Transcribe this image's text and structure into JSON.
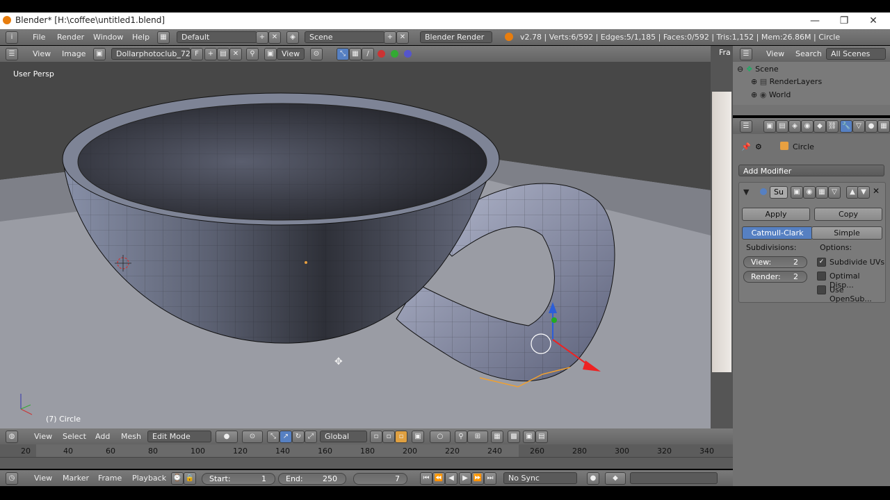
{
  "window": {
    "title": "Blender* [H:\\coffee\\untitled1.blend]",
    "minimize": "—",
    "maximize": "❐",
    "close": "✕"
  },
  "info": {
    "menus": [
      "File",
      "Render",
      "Window",
      "Help"
    ],
    "layout": "Default",
    "scene": "Scene",
    "engine": "Blender Render",
    "stats": "v2.78 | Verts:6/592 | Edges:5/1,185 | Faces:0/592 | Tris:1,152 | Mem:26.86M | Circle"
  },
  "image_header": {
    "view": "View",
    "image": "Image",
    "image_name": "Dollarphotoclub_72...",
    "f_label": "F",
    "view_label": "View",
    "right_label": "Fra"
  },
  "viewport": {
    "persp": "User Persp",
    "object": "(7) Circle"
  },
  "view3d_header": {
    "menus": [
      "View",
      "Select",
      "Add",
      "Mesh"
    ],
    "mode": "Edit Mode",
    "orientation": "Global"
  },
  "outliner": {
    "menus": [
      "View",
      "Search"
    ],
    "filter": "All Scenes",
    "items": [
      {
        "label": "Scene",
        "icon": "scene-icon"
      },
      {
        "label": "RenderLayers",
        "icon": "renderlayers-icon"
      },
      {
        "label": "World",
        "icon": "world-icon"
      }
    ]
  },
  "properties": {
    "object": "Circle",
    "add_modifier": "Add Modifier",
    "modifier_name": "Su",
    "apply": "Apply",
    "copy": "Copy",
    "tabs": [
      "Catmull-Clark",
      "Simple"
    ],
    "active_tab": "Catmull-Clark",
    "subdivisions_label": "Subdivisions:",
    "options_label": "Options:",
    "view_label": "View:",
    "view_value": "2",
    "render_label": "Render:",
    "render_value": "2",
    "options": [
      {
        "label": "Subdivide UVs",
        "checked": true
      },
      {
        "label": "Optimal Disp...",
        "checked": false
      },
      {
        "label": "Use OpenSub...",
        "checked": false
      }
    ]
  },
  "timeline": {
    "ticks": [
      "20",
      "40",
      "60",
      "80",
      "100",
      "120",
      "140",
      "160",
      "180",
      "200",
      "220",
      "240",
      "260",
      "280",
      "300",
      "320",
      "340"
    ],
    "menus": [
      "View",
      "Marker",
      "Frame",
      "Playback"
    ],
    "start_label": "Start:",
    "start_value": "1",
    "end_label": "End:",
    "end_value": "250",
    "current": "7",
    "sync": "No Sync"
  },
  "colors": {
    "accent_blue": "#5680c2",
    "header_gray": "#727272",
    "viewport_bg": "#3f3f3f"
  }
}
